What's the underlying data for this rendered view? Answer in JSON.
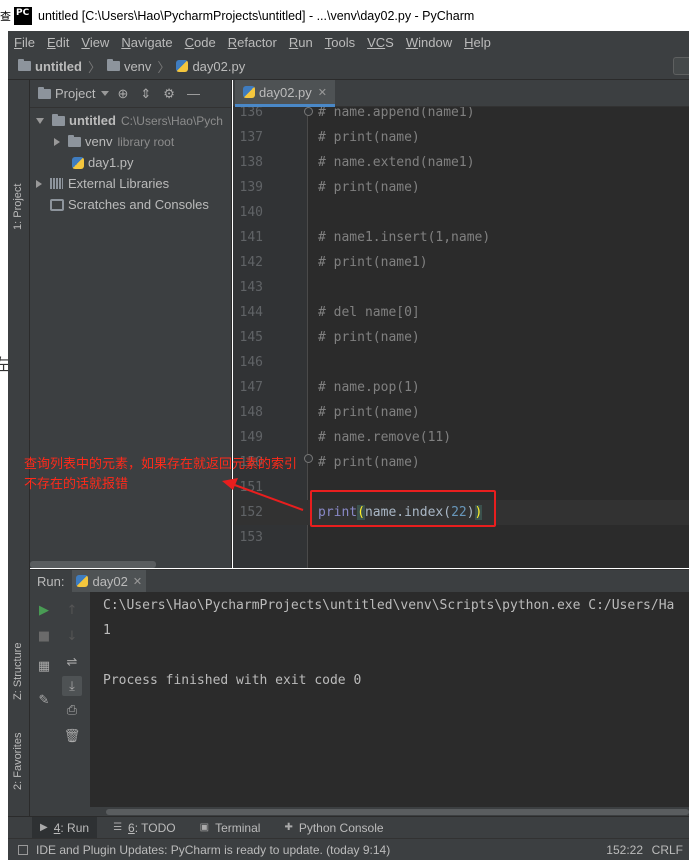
{
  "titlebar": {
    "logo": "PC",
    "title": "untitled [C:\\Users\\Hao\\PycharmProjects\\untitled] - ...\\venv\\day02.py - PyCharm",
    "left_cut": "查"
  },
  "outer_fragment": "左",
  "menu": [
    {
      "u": "F",
      "rest": "ile"
    },
    {
      "u": "E",
      "rest": "dit"
    },
    {
      "u": "V",
      "rest": "iew"
    },
    {
      "u": "N",
      "rest": "avigate"
    },
    {
      "u": "C",
      "rest": "ode"
    },
    {
      "u": "R",
      "rest": "efactor"
    },
    {
      "u": "R",
      "rest": "un"
    },
    {
      "u": "T",
      "rest": "ools"
    },
    {
      "u": "VC",
      "rest": "S"
    },
    {
      "u": "W",
      "rest": "indow"
    },
    {
      "u": "H",
      "rest": "elp"
    }
  ],
  "breadcrumb": [
    "untitled",
    "venv",
    "day02.py"
  ],
  "left_stripe": {
    "project": "1: Project",
    "structure": "Z: Structure",
    "favorites": "2: Favorites"
  },
  "project_panel": {
    "title": "Project",
    "tree": {
      "root_name": "untitled",
      "root_path": "C:\\Users\\Hao\\Pych",
      "venv": "venv",
      "venv_note": "library root",
      "day1": "day1.py",
      "external": "External Libraries",
      "scratches": "Scratches and Consoles"
    }
  },
  "editor": {
    "tab": "day02.py",
    "lines": [
      {
        "n": "136",
        "code": "# name.append(name1)"
      },
      {
        "n": "137",
        "code": "# print(name)"
      },
      {
        "n": "138",
        "code": "# name.extend(name1)"
      },
      {
        "n": "139",
        "code": "# print(name)"
      },
      {
        "n": "140",
        "code": ""
      },
      {
        "n": "141",
        "code": "# name1.insert(1,name)"
      },
      {
        "n": "142",
        "code": "# print(name1)"
      },
      {
        "n": "143",
        "code": ""
      },
      {
        "n": "144",
        "code": "# del name[0]"
      },
      {
        "n": "145",
        "code": "# print(name)"
      },
      {
        "n": "146",
        "code": ""
      },
      {
        "n": "147",
        "code": "# name.pop(1)"
      },
      {
        "n": "148",
        "code": "# print(name)"
      },
      {
        "n": "149",
        "code": "# name.remove(11)"
      },
      {
        "n": "150",
        "code": "# print(name)"
      },
      {
        "n": "151",
        "code": ""
      },
      {
        "n": "152",
        "code": ""
      },
      {
        "n": "153",
        "code": ""
      }
    ],
    "current_line": {
      "kw": "print",
      "open": "(",
      "mid": "name.index(",
      "num": "22",
      "close1": ")",
      "close2": ")"
    }
  },
  "annotation": {
    "line1": "查询列表中的元素，如果存在就返回元素的索引",
    "line2": "不存在的话就报错"
  },
  "run_panel": {
    "label": "Run:",
    "tab": "day02",
    "output": [
      "C:\\Users\\Hao\\PycharmProjects\\untitled\\venv\\Scripts\\python.exe C:/Users/Ha",
      "1",
      "",
      "Process finished with exit code 0"
    ]
  },
  "bottom_tabs": [
    {
      "icon": "▶",
      "u": "4",
      "rest": ": Run",
      "active": true
    },
    {
      "icon": "☰",
      "u": "6",
      "rest": ": TODO",
      "active": false
    },
    {
      "icon": "▣",
      "u": "",
      "rest": "Terminal",
      "active": false
    },
    {
      "icon": "✚",
      "u": "",
      "rest": "Python Console",
      "active": false
    }
  ],
  "status": {
    "message": "IDE and Plugin Updates: PyCharm is ready to update. (today 9:14)",
    "position": "152:22",
    "line_sep": "CRLF"
  },
  "colors": {
    "annotation": "#ff2a1a",
    "highlight_box": "#e81e1e",
    "run_green": "#499c54"
  }
}
